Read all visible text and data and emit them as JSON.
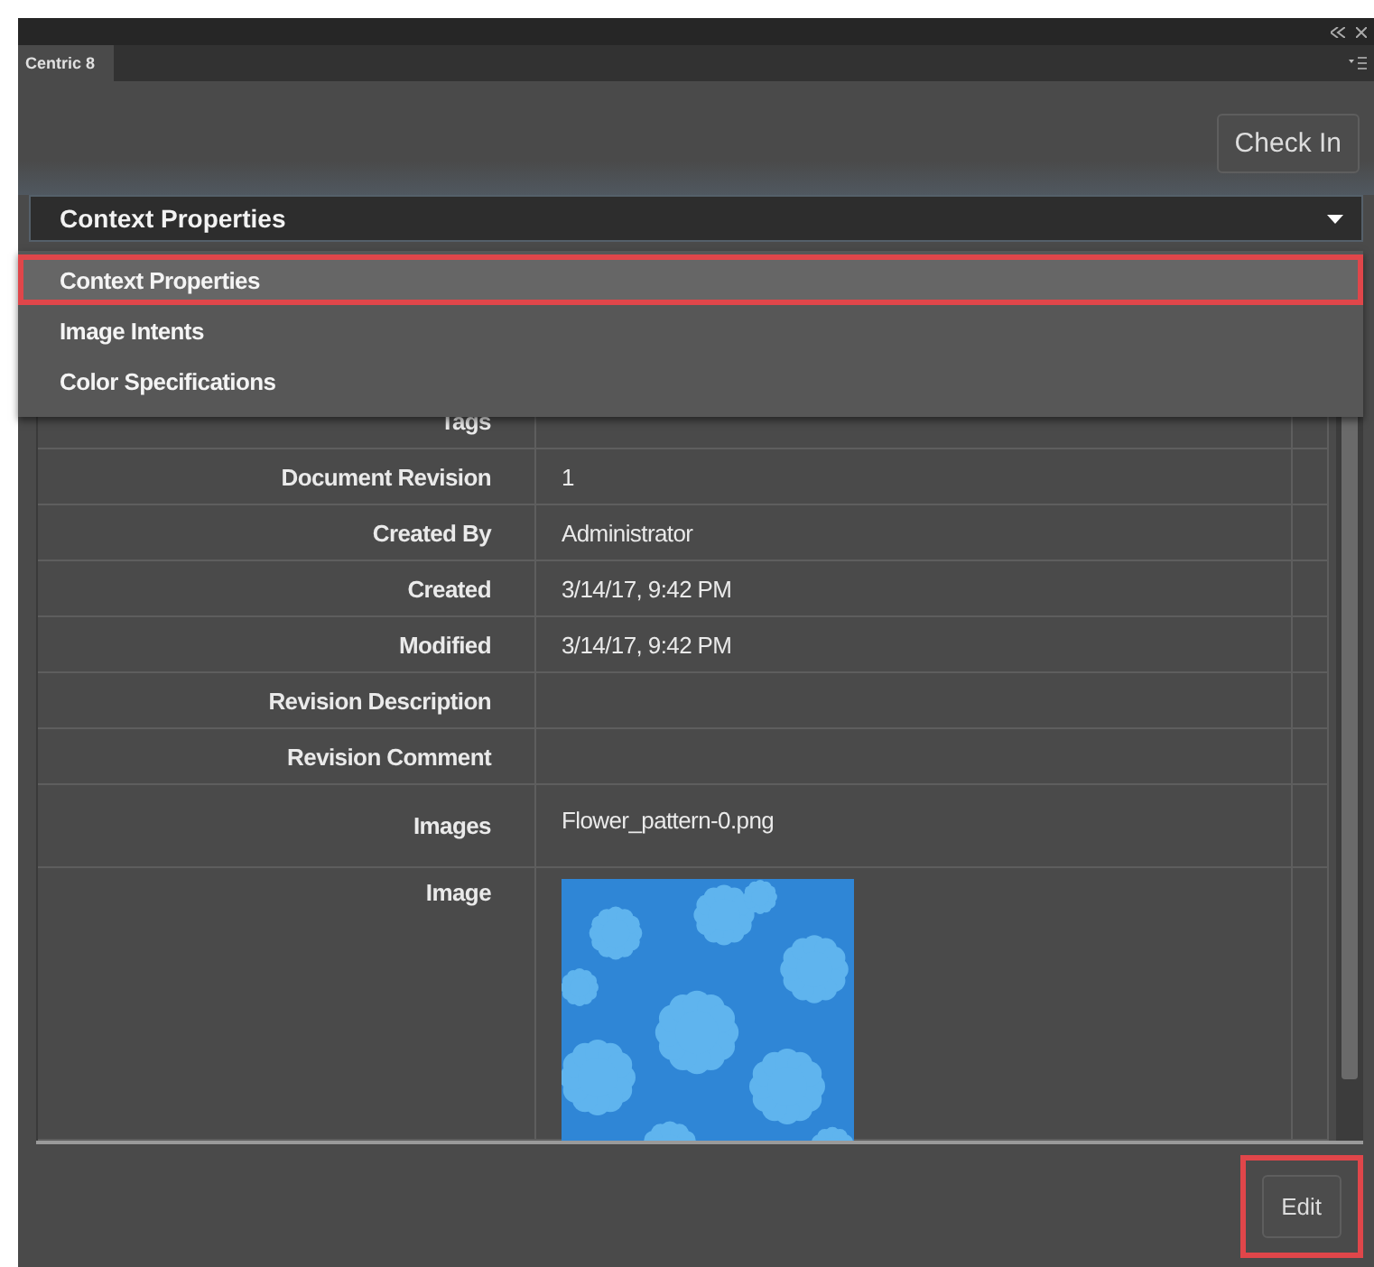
{
  "panel": {
    "tab": "Centric 8",
    "check_in_button": "Check In"
  },
  "view_select": {
    "value": "Context Properties",
    "expanded": true,
    "options": [
      {
        "label": "Context Properties",
        "selected": true,
        "annotated": true
      },
      {
        "label": "Image Intents",
        "selected": false,
        "annotated": false
      },
      {
        "label": "Color Specifications",
        "selected": false,
        "annotated": false
      }
    ]
  },
  "properties": [
    {
      "label": "Tags"
    },
    {
      "label": "Document Revision",
      "value": "1"
    },
    {
      "label": "Created By",
      "value": "Administrator"
    },
    {
      "label": "Created",
      "value": "3/14/17, 9:42 PM"
    },
    {
      "label": "Modified",
      "value": "3/14/17, 9:42 PM"
    },
    {
      "label": "Revision Description"
    },
    {
      "label": "Revision Comment"
    },
    {
      "label": "Images",
      "value": "Flower_pattern-0.png"
    },
    {
      "label": "Image",
      "kind": "picture"
    }
  ],
  "footer": {
    "edit_button": "Edit",
    "annotated": true
  }
}
